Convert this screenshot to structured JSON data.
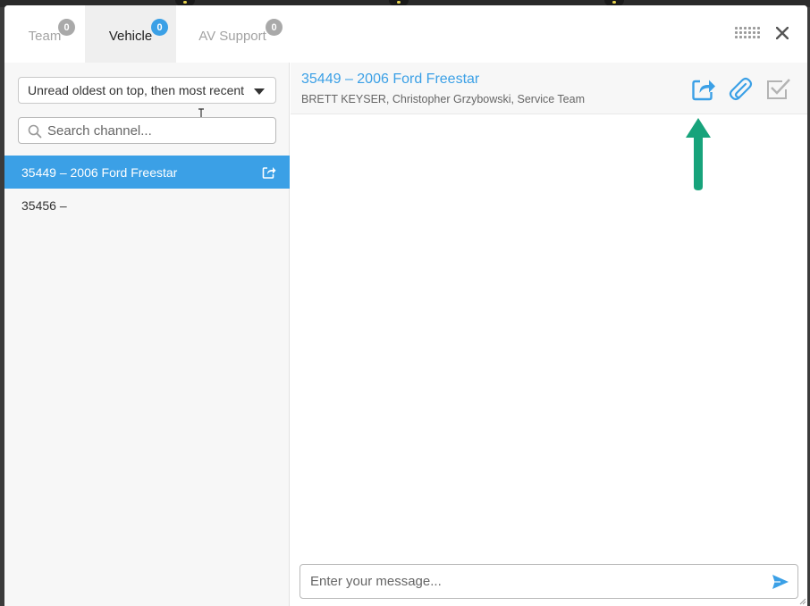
{
  "tabs": [
    {
      "label": "Team",
      "badge": "0",
      "active": false
    },
    {
      "label": "Vehicle",
      "badge": "0",
      "active": true
    },
    {
      "label": "AV Support",
      "badge": "0",
      "active": false
    }
  ],
  "toolbar": {
    "grid_icon": "grid-icon",
    "close_icon": "close-icon"
  },
  "sort": {
    "selected": "Unread oldest on top, then most recent"
  },
  "search": {
    "placeholder": "Search channel..."
  },
  "channels": [
    {
      "label": "35449 – 2006 Ford Freestar",
      "active": true
    },
    {
      "label": "35456 –",
      "active": false
    }
  ],
  "conversation": {
    "title": "35449 – 2006 Ford Freestar",
    "members": "BRETT KEYSER, Christopher Grzybowski, Service Team"
  },
  "composer": {
    "placeholder": "Enter your message..."
  },
  "colors": {
    "accent": "#3ba0e6",
    "annotation_arrow": "#17a37b"
  }
}
